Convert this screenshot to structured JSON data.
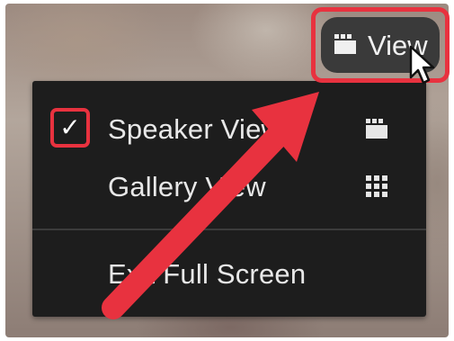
{
  "view_button": {
    "label": "View",
    "icon": "speaker-view-icon"
  },
  "menu": {
    "items": [
      {
        "label": "Speaker View",
        "checked": true,
        "icon": "speaker-view-icon"
      },
      {
        "label": "Gallery View",
        "checked": false,
        "icon": "gallery-grid-icon"
      }
    ],
    "exit_label": "Exit Full Screen",
    "check_glyph": "✓"
  },
  "annotation": {
    "color": "#e8323f"
  }
}
